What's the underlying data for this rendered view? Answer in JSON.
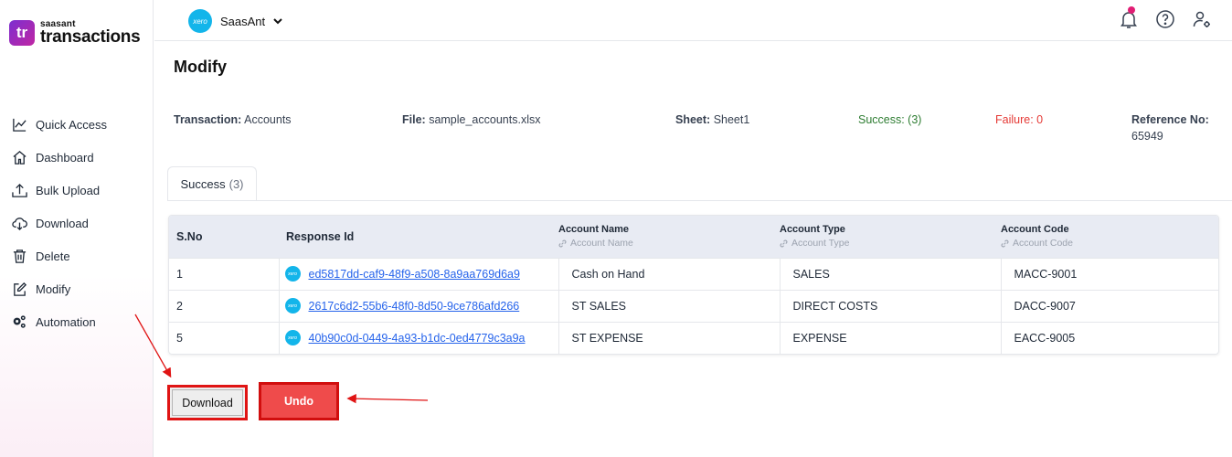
{
  "brand": {
    "small": "saasant",
    "big": "transactions",
    "box": "tr",
    "color": "#8b2fd0"
  },
  "sidebar": {
    "items": [
      {
        "label": "Quick Access",
        "icon": "chart-line-icon"
      },
      {
        "label": "Dashboard",
        "icon": "home-icon"
      },
      {
        "label": "Bulk Upload",
        "icon": "upload-icon"
      },
      {
        "label": "Download",
        "icon": "cloud-download-icon"
      },
      {
        "label": "Delete",
        "icon": "trash-icon"
      },
      {
        "label": "Modify",
        "icon": "edit-icon"
      },
      {
        "label": "Automation",
        "icon": "gears-icon"
      }
    ]
  },
  "topbar": {
    "org_logo_text": "xero",
    "org_name": "SaasAnt",
    "icons": [
      "bell-icon",
      "help-icon",
      "user-settings-icon"
    ]
  },
  "page": {
    "title": "Modify",
    "info": {
      "transaction_label": "Transaction:",
      "transaction_value": "Accounts",
      "file_label": "File:",
      "file_value": "sample_accounts.xlsx",
      "sheet_label": "Sheet:",
      "sheet_value": "Sheet1",
      "success_text": "Success: (3)",
      "failure_text": "Failure: 0",
      "reference_label": "Reference No:",
      "reference_value": "65949"
    },
    "tab": {
      "label": "Success",
      "count": "(3)"
    }
  },
  "table": {
    "headers": {
      "sno": "S.No",
      "response_id": "Response Id",
      "account_name": "Account Name",
      "account_name_sub": "Account Name",
      "account_type": "Account Type",
      "account_type_sub": "Account Type",
      "account_code": "Account Code",
      "account_code_sub": "Account Code"
    },
    "rows": [
      {
        "sno": "1",
        "response_id": "ed5817dd-caf9-48f9-a508-8a9aa769d6a9",
        "account_name": "Cash on Hand",
        "account_type": "SALES",
        "account_code": "MACC-9001"
      },
      {
        "sno": "2",
        "response_id": "2617c6d2-55b6-48f0-8d50-9ce786afd266",
        "account_name": "ST SALES",
        "account_type": "DIRECT COSTS",
        "account_code": "DACC-9007"
      },
      {
        "sno": "5",
        "response_id": "40b90c0d-0449-4a93-b1dc-0ed4779c3a9a",
        "account_name": "ST EXPENSE",
        "account_type": "EXPENSE",
        "account_code": "EACC-9005"
      }
    ]
  },
  "actions": {
    "download_label": "Download",
    "undo_label": "Undo"
  },
  "colors": {
    "xero": "#13b5ea",
    "success": "#2e7d32",
    "failure": "#e53935",
    "undo": "#ef4b4b",
    "annotation": "#e01414",
    "link": "#2563eb"
  }
}
